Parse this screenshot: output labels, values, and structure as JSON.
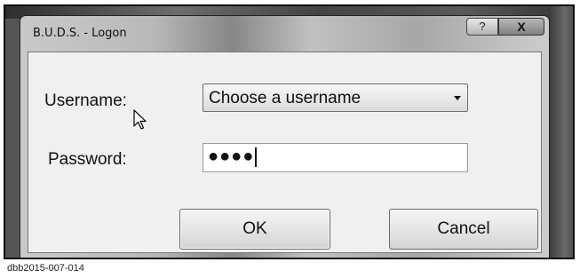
{
  "window": {
    "title": "B.U.D.S. - Logon",
    "help_label": "?",
    "close_label": "X"
  },
  "form": {
    "username_label": "Username:",
    "username_value": "Choose a username",
    "password_label": "Password:",
    "password_value": "●●●●"
  },
  "buttons": {
    "ok_label": "OK",
    "cancel_label": "Cancel"
  },
  "caption": "dbb2015-007-014",
  "icons": [
    "mouse-pointer-icon",
    "dropdown-arrow-icon"
  ]
}
